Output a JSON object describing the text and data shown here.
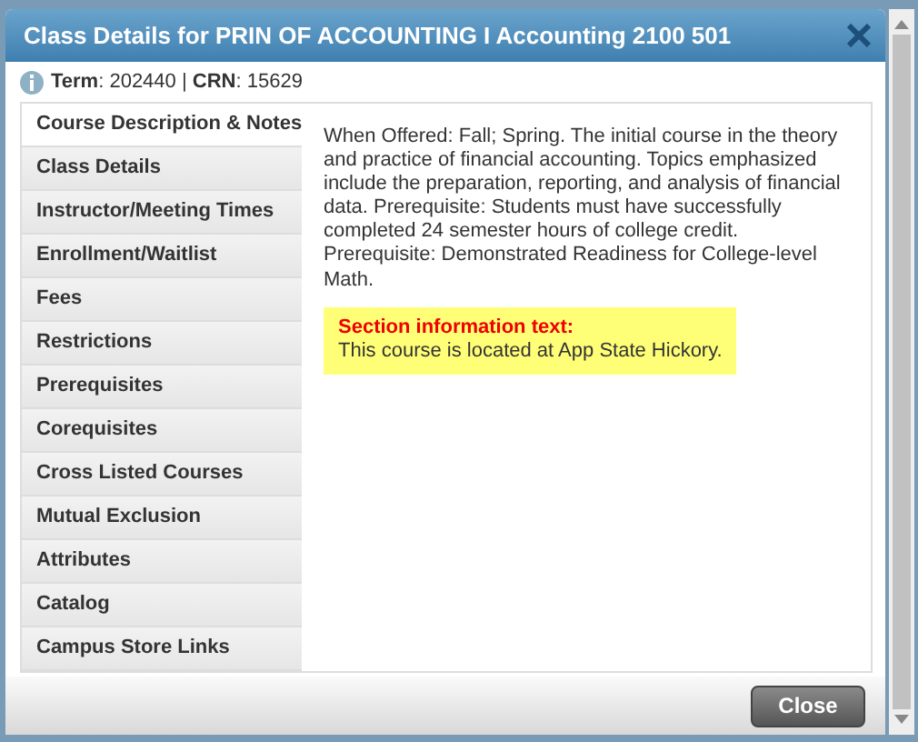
{
  "dialog": {
    "title": "Class Details for PRIN OF ACCOUNTING I Accounting 2100 501",
    "info": "**Term**: 202440 | **CRN**: 15629"
  },
  "tabs": [
    {
      "label": "Course Description & Notes",
      "selected": true
    },
    {
      "label": "Class Details",
      "selected": false
    },
    {
      "label": "Instructor/Meeting Times",
      "selected": false
    },
    {
      "label": "Enrollment/Waitlist",
      "selected": false
    },
    {
      "label": "Fees",
      "selected": false
    },
    {
      "label": "Restrictions",
      "selected": false
    },
    {
      "label": "Prerequisites",
      "selected": false
    },
    {
      "label": "Corequisites",
      "selected": false
    },
    {
      "label": "Cross Listed Courses",
      "selected": false
    },
    {
      "label": "Mutual Exclusion",
      "selected": false
    },
    {
      "label": "Attributes",
      "selected": false
    },
    {
      "label": "Catalog",
      "selected": false
    },
    {
      "label": "Campus Store Links",
      "selected": false
    }
  ],
  "content": {
    "description": "When Offered: Fall; Spring. The initial course in the theory and practice of financial accounting. Topics emphasized include the preparation, reporting, and analysis of financial data. Prerequisite: Students must have successfully completed 24 semester hours of college credit. Prerequisite: Demonstrated Readiness for College-level Math.",
    "section_info": {
      "heading": "Section information text:",
      "text": "This course is located at App State Hickory."
    }
  },
  "buttons": [
    "Close"
  ]
}
